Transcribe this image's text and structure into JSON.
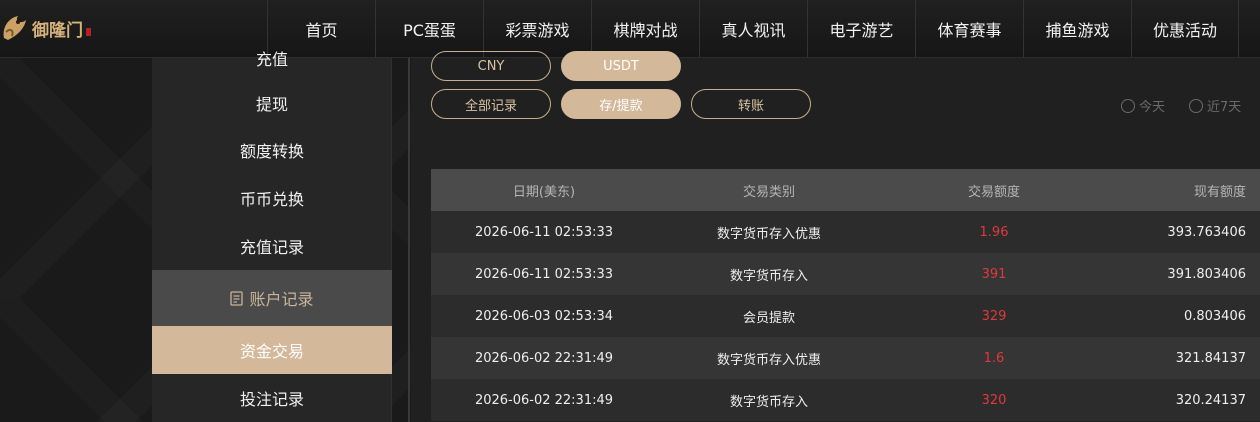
{
  "brand": {
    "name": "御隆门"
  },
  "nav": {
    "items": [
      "首页",
      "PC蛋蛋",
      "彩票游戏",
      "棋牌对战",
      "真人视讯",
      "电子游艺",
      "体育赛事",
      "捕鱼游戏",
      "优惠活动"
    ]
  },
  "sidebar": {
    "items": [
      {
        "label": "充值",
        "state": "normal"
      },
      {
        "label": "提现",
        "state": "normal"
      },
      {
        "label": "额度转换",
        "state": "normal"
      },
      {
        "label": "币币兑换",
        "state": "normal"
      },
      {
        "label": "充值记录",
        "state": "normal"
      },
      {
        "label": "账户记录",
        "state": "group",
        "icon": "document-icon"
      },
      {
        "label": "资金交易",
        "state": "active"
      },
      {
        "label": "投注记录",
        "state": "normal"
      }
    ]
  },
  "currency_tabs": [
    {
      "label": "CNY",
      "active": false
    },
    {
      "label": "USDT",
      "active": true
    }
  ],
  "record_tabs": [
    {
      "label": "全部记录",
      "active": false
    },
    {
      "label": "存/提款",
      "active": true
    },
    {
      "label": "转账",
      "active": false
    }
  ],
  "date_filters": [
    {
      "label": "今天",
      "checked": false
    },
    {
      "label": "近7天",
      "checked": false
    }
  ],
  "table": {
    "headers": [
      "日期(美东)",
      "交易类别",
      "交易额度",
      "现有额度"
    ],
    "rows": [
      [
        "2026-06-11 02:53:33",
        "数字货币存入优惠",
        "1.96",
        "393.763406"
      ],
      [
        "2026-06-11 02:53:33",
        "数字货币存入",
        "391",
        "391.803406"
      ],
      [
        "2026-06-03 02:53:34",
        "会员提款",
        "329",
        "0.803406"
      ],
      [
        "2026-06-02 22:31:49",
        "数字货币存入优惠",
        "1.6",
        "321.84137"
      ],
      [
        "2026-06-02 22:31:49",
        "数字货币存入",
        "320",
        "320.24137"
      ]
    ]
  },
  "colors": {
    "accent": "#d4b89a",
    "amount": "#e0383e",
    "background": "#1a1a1a"
  }
}
